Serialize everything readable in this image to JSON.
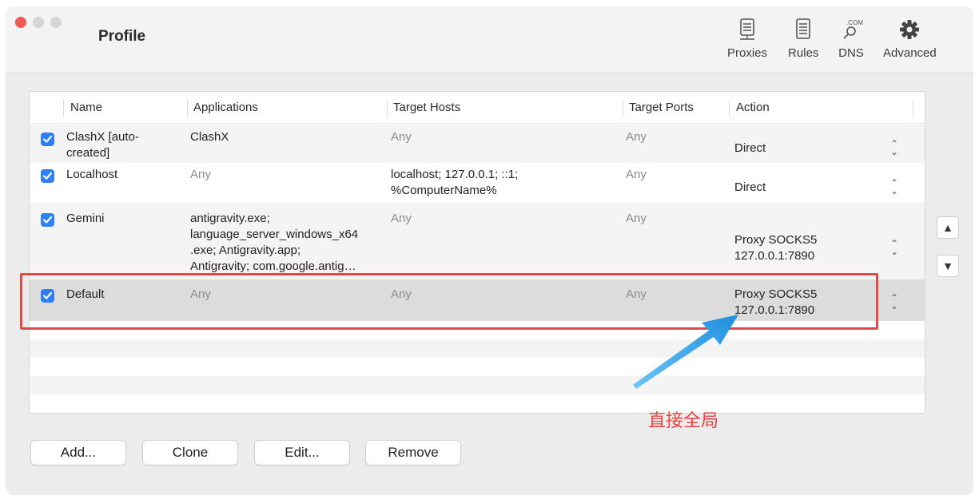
{
  "window": {
    "title": "Profile"
  },
  "toolbar": {
    "items": [
      {
        "label": "Proxies",
        "icon": "server-icon"
      },
      {
        "label": "Rules",
        "icon": "document-list-icon"
      },
      {
        "label": "DNS",
        "icon": "dns-search-icon",
        "badge": ".COM"
      },
      {
        "label": "Advanced",
        "icon": "gear-icon"
      }
    ]
  },
  "table": {
    "headers": [
      "Name",
      "Applications",
      "Target Hosts",
      "Target Ports",
      "Action"
    ],
    "rows": [
      {
        "checked": true,
        "name_line1": "ClashX [auto-",
        "name_line2": "created]",
        "applications": "ClashX",
        "hosts": "Any",
        "ports": "Any",
        "action_line1": "Direct",
        "action_line2": ""
      },
      {
        "checked": true,
        "name_line1": "Localhost",
        "name_line2": "",
        "applications": "Any",
        "hosts_line1": "localhost; 127.0.0.1; ::1;",
        "hosts_line2": "%ComputerName%",
        "ports": "Any",
        "action_line1": "Direct",
        "action_line2": ""
      },
      {
        "checked": true,
        "name_line1": "Gemini",
        "name_line2": "",
        "apps_line1": "antigravity.exe;",
        "apps_line2": "language_server_windows_x64",
        "apps_line3": ".exe;  Antigravity.app;",
        "apps_line4": "Antigravity; com.google.antig…",
        "hosts": "Any",
        "ports": "Any",
        "action_line1": "Proxy SOCKS5",
        "action_line2": "127.0.0.1:7890"
      },
      {
        "checked": true,
        "name_line1": "Default",
        "name_line2": "",
        "applications": "Any",
        "hosts": "Any",
        "ports": "Any",
        "action_line1": "Proxy SOCKS5",
        "action_line2": "127.0.0.1:7890",
        "selected": true
      }
    ]
  },
  "side_buttons": {
    "up": "▲",
    "down": "▼"
  },
  "buttons": {
    "add": "Add...",
    "clone": "Clone",
    "edit": "Edit...",
    "remove": "Remove"
  },
  "annotation": {
    "text": "直接全局",
    "color": "#e8433f"
  },
  "colors": {
    "accent": "#2f7ff6",
    "annotation_red": "#e04a4a",
    "arrow_blue": "#2d9ee8"
  }
}
